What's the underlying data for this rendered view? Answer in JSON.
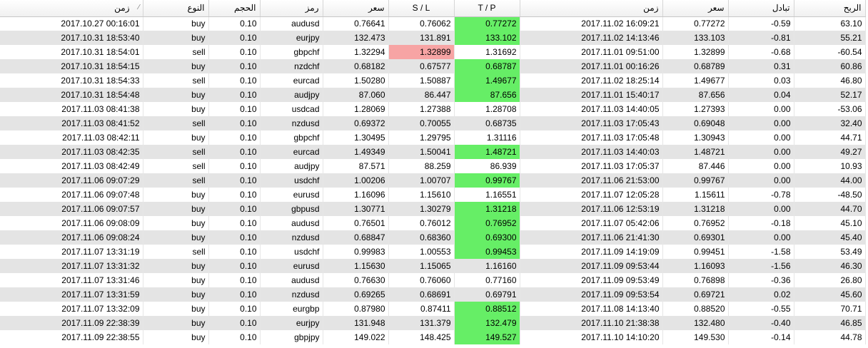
{
  "headers": [
    "زمن",
    "النوع",
    "الحجم",
    "رمز",
    "سعر",
    "S / L",
    "T / P",
    "زمن",
    "سعر",
    "تبادل",
    "الربح"
  ],
  "highlight_colors": {
    "green": "#66ee66",
    "pink": "#f7a4a4"
  },
  "rows": [
    {
      "open_time": "2017.10.27 00:16:01",
      "type": "buy",
      "volume": "0.10",
      "symbol": "audusd",
      "open_price": "0.76641",
      "sl": "0.76062",
      "tp": "0.77272",
      "close_time": "2017.11.02 16:09:21",
      "close_price": "0.77272",
      "swap": "-0.59",
      "profit": "63.10",
      "hl": "tp"
    },
    {
      "open_time": "2017.10.31 18:53:40",
      "type": "buy",
      "volume": "0.10",
      "symbol": "eurjpy",
      "open_price": "132.473",
      "sl": "131.891",
      "tp": "133.102",
      "close_time": "2017.11.02 14:13:46",
      "close_price": "133.103",
      "swap": "-0.81",
      "profit": "55.21",
      "hl": "tp"
    },
    {
      "open_time": "2017.10.31 18:54:01",
      "type": "sell",
      "volume": "0.10",
      "symbol": "gbpchf",
      "open_price": "1.32294",
      "sl": "1.32899",
      "tp": "1.31692",
      "close_time": "2017.11.01 09:51:00",
      "close_price": "1.32899",
      "swap": "-0.68",
      "profit": "-60.54",
      "hl": "sl"
    },
    {
      "open_time": "2017.10.31 18:54:15",
      "type": "buy",
      "volume": "0.10",
      "symbol": "nzdchf",
      "open_price": "0.68182",
      "sl": "0.67577",
      "tp": "0.68787",
      "close_time": "2017.11.01 00:16:26",
      "close_price": "0.68789",
      "swap": "0.31",
      "profit": "60.86",
      "hl": "tp"
    },
    {
      "open_time": "2017.10.31 18:54:33",
      "type": "sell",
      "volume": "0.10",
      "symbol": "eurcad",
      "open_price": "1.50280",
      "sl": "1.50887",
      "tp": "1.49677",
      "close_time": "2017.11.02 18:25:14",
      "close_price": "1.49677",
      "swap": "0.03",
      "profit": "46.80",
      "hl": "tp"
    },
    {
      "open_time": "2017.10.31 18:54:48",
      "type": "buy",
      "volume": "0.10",
      "symbol": "audjpy",
      "open_price": "87.060",
      "sl": "86.447",
      "tp": "87.656",
      "close_time": "2017.11.01 15:40:17",
      "close_price": "87.656",
      "swap": "0.04",
      "profit": "52.17",
      "hl": "tp"
    },
    {
      "open_time": "2017.11.03 08:41:38",
      "type": "buy",
      "volume": "0.10",
      "symbol": "usdcad",
      "open_price": "1.28069",
      "sl": "1.27388",
      "tp": "1.28708",
      "close_time": "2017.11.03 14:40:05",
      "close_price": "1.27393",
      "swap": "0.00",
      "profit": "-53.06",
      "hl": ""
    },
    {
      "open_time": "2017.11.03 08:41:52",
      "type": "sell",
      "volume": "0.10",
      "symbol": "nzdusd",
      "open_price": "0.69372",
      "sl": "0.70055",
      "tp": "0.68735",
      "close_time": "2017.11.03 17:05:43",
      "close_price": "0.69048",
      "swap": "0.00",
      "profit": "32.40",
      "hl": ""
    },
    {
      "open_time": "2017.11.03 08:42:11",
      "type": "buy",
      "volume": "0.10",
      "symbol": "gbpchf",
      "open_price": "1.30495",
      "sl": "1.29795",
      "tp": "1.31116",
      "close_time": "2017.11.03 17:05:48",
      "close_price": "1.30943",
      "swap": "0.00",
      "profit": "44.71",
      "hl": ""
    },
    {
      "open_time": "2017.11.03 08:42:35",
      "type": "sell",
      "volume": "0.10",
      "symbol": "eurcad",
      "open_price": "1.49349",
      "sl": "1.50041",
      "tp": "1.48721",
      "close_time": "2017.11.03 14:40:03",
      "close_price": "1.48721",
      "swap": "0.00",
      "profit": "49.27",
      "hl": "tp"
    },
    {
      "open_time": "2017.11.03 08:42:49",
      "type": "sell",
      "volume": "0.10",
      "symbol": "audjpy",
      "open_price": "87.571",
      "sl": "88.259",
      "tp": "86.939",
      "close_time": "2017.11.03 17:05:37",
      "close_price": "87.446",
      "swap": "0.00",
      "profit": "10.93",
      "hl": ""
    },
    {
      "open_time": "2017.11.06 09:07:29",
      "type": "sell",
      "volume": "0.10",
      "symbol": "usdchf",
      "open_price": "1.00206",
      "sl": "1.00707",
      "tp": "0.99767",
      "close_time": "2017.11.06 21:53:00",
      "close_price": "0.99767",
      "swap": "0.00",
      "profit": "44.00",
      "hl": "tp"
    },
    {
      "open_time": "2017.11.06 09:07:48",
      "type": "buy",
      "volume": "0.10",
      "symbol": "eurusd",
      "open_price": "1.16096",
      "sl": "1.15610",
      "tp": "1.16551",
      "close_time": "2017.11.07 12:05:28",
      "close_price": "1.15611",
      "swap": "-0.78",
      "profit": "-48.50",
      "hl": ""
    },
    {
      "open_time": "2017.11.06 09:07:57",
      "type": "buy",
      "volume": "0.10",
      "symbol": "gbpusd",
      "open_price": "1.30771",
      "sl": "1.30279",
      "tp": "1.31218",
      "close_time": "2017.11.06 12:53:19",
      "close_price": "1.31218",
      "swap": "0.00",
      "profit": "44.70",
      "hl": "tp"
    },
    {
      "open_time": "2017.11.06 09:08:09",
      "type": "buy",
      "volume": "0.10",
      "symbol": "audusd",
      "open_price": "0.76501",
      "sl": "0.76012",
      "tp": "0.76952",
      "close_time": "2017.11.07 05:42:06",
      "close_price": "0.76952",
      "swap": "-0.18",
      "profit": "45.10",
      "hl": "tp"
    },
    {
      "open_time": "2017.11.06 09:08:24",
      "type": "buy",
      "volume": "0.10",
      "symbol": "nzdusd",
      "open_price": "0.68847",
      "sl": "0.68360",
      "tp": "0.69300",
      "close_time": "2017.11.06 21:41:30",
      "close_price": "0.69301",
      "swap": "0.00",
      "profit": "45.40",
      "hl": "tp"
    },
    {
      "open_time": "2017.11.07 13:31:19",
      "type": "sell",
      "volume": "0.10",
      "symbol": "usdchf",
      "open_price": "0.99983",
      "sl": "1.00553",
      "tp": "0.99453",
      "close_time": "2017.11.09 14:19:09",
      "close_price": "0.99451",
      "swap": "-1.58",
      "profit": "53.49",
      "hl": "tp"
    },
    {
      "open_time": "2017.11.07 13:31:32",
      "type": "buy",
      "volume": "0.10",
      "symbol": "eurusd",
      "open_price": "1.15630",
      "sl": "1.15065",
      "tp": "1.16160",
      "close_time": "2017.11.09 09:53:44",
      "close_price": "1.16093",
      "swap": "-1.56",
      "profit": "46.30",
      "hl": ""
    },
    {
      "open_time": "2017.11.07 13:31:46",
      "type": "buy",
      "volume": "0.10",
      "symbol": "audusd",
      "open_price": "0.76630",
      "sl": "0.76060",
      "tp": "0.77160",
      "close_time": "2017.11.09 09:53:49",
      "close_price": "0.76898",
      "swap": "-0.36",
      "profit": "26.80",
      "hl": ""
    },
    {
      "open_time": "2017.11.07 13:31:59",
      "type": "buy",
      "volume": "0.10",
      "symbol": "nzdusd",
      "open_price": "0.69265",
      "sl": "0.68691",
      "tp": "0.69791",
      "close_time": "2017.11.09 09:53:54",
      "close_price": "0.69721",
      "swap": "0.02",
      "profit": "45.60",
      "hl": ""
    },
    {
      "open_time": "2017.11.07 13:32:09",
      "type": "buy",
      "volume": "0.10",
      "symbol": "eurgbp",
      "open_price": "0.87980",
      "sl": "0.87411",
      "tp": "0.88512",
      "close_time": "2017.11.08 14:13:40",
      "close_price": "0.88520",
      "swap": "-0.55",
      "profit": "70.71",
      "hl": "tp"
    },
    {
      "open_time": "2017.11.09 22:38:39",
      "type": "buy",
      "volume": "0.10",
      "symbol": "eurjpy",
      "open_price": "131.948",
      "sl": "131.379",
      "tp": "132.479",
      "close_time": "2017.11.10 21:38:38",
      "close_price": "132.480",
      "swap": "-0.40",
      "profit": "46.85",
      "hl": "tp"
    },
    {
      "open_time": "2017.11.09 22:38:55",
      "type": "buy",
      "volume": "0.10",
      "symbol": "gbpjpy",
      "open_price": "149.022",
      "sl": "148.425",
      "tp": "149.527",
      "close_time": "2017.11.10 14:10:20",
      "close_price": "149.530",
      "swap": "-0.14",
      "profit": "44.78",
      "hl": "tp"
    }
  ]
}
